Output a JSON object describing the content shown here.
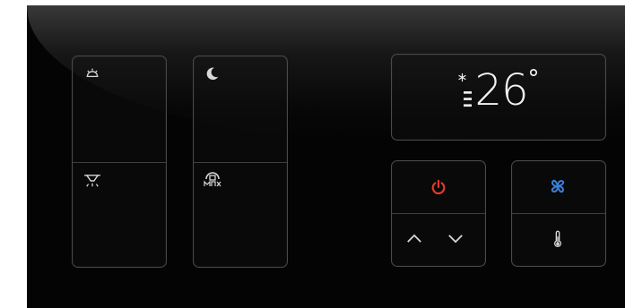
{
  "thermostat": {
    "temperature": "26",
    "unit": "°"
  },
  "scenes": [
    "sun-icon",
    "ceiling-light-icon",
    "moon-icon",
    "away-home-icon"
  ],
  "climate": {
    "power_color": "#e03b2e",
    "fan_color": "#3b7fd6"
  }
}
